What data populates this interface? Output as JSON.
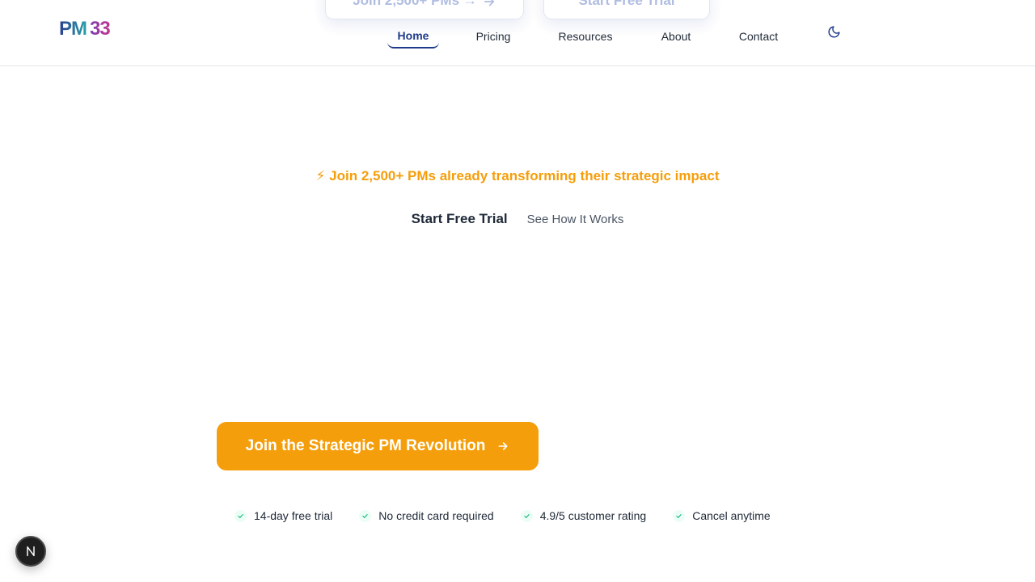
{
  "brand": {
    "logo_prefix": "PM",
    "logo_suffix": "33"
  },
  "ghost_buttons": {
    "join": "Join 2,500+ PMs →",
    "trial": "Start Free Trial"
  },
  "nav": {
    "items": [
      {
        "label": "Home",
        "active": true
      },
      {
        "label": "Pricing"
      },
      {
        "label": "Resources"
      },
      {
        "label": "About"
      },
      {
        "label": "Contact"
      }
    ],
    "theme_toggle_icon": "moon-icon"
  },
  "hero": {
    "social_proof_icon": "⚡",
    "social_proof": "Join 2,500+ PMs already transforming their strategic impact",
    "primary_link": "Start Free Trial",
    "secondary_link": "See How It Works",
    "cta_label": "Join the Strategic PM Revolution",
    "accent_color": "#f59e0b"
  },
  "trust_badges": [
    "14-day free trial",
    "No credit card required",
    "4.9/5 customer rating",
    "Cancel anytime"
  ],
  "floating_badge": {
    "letter": "N"
  }
}
